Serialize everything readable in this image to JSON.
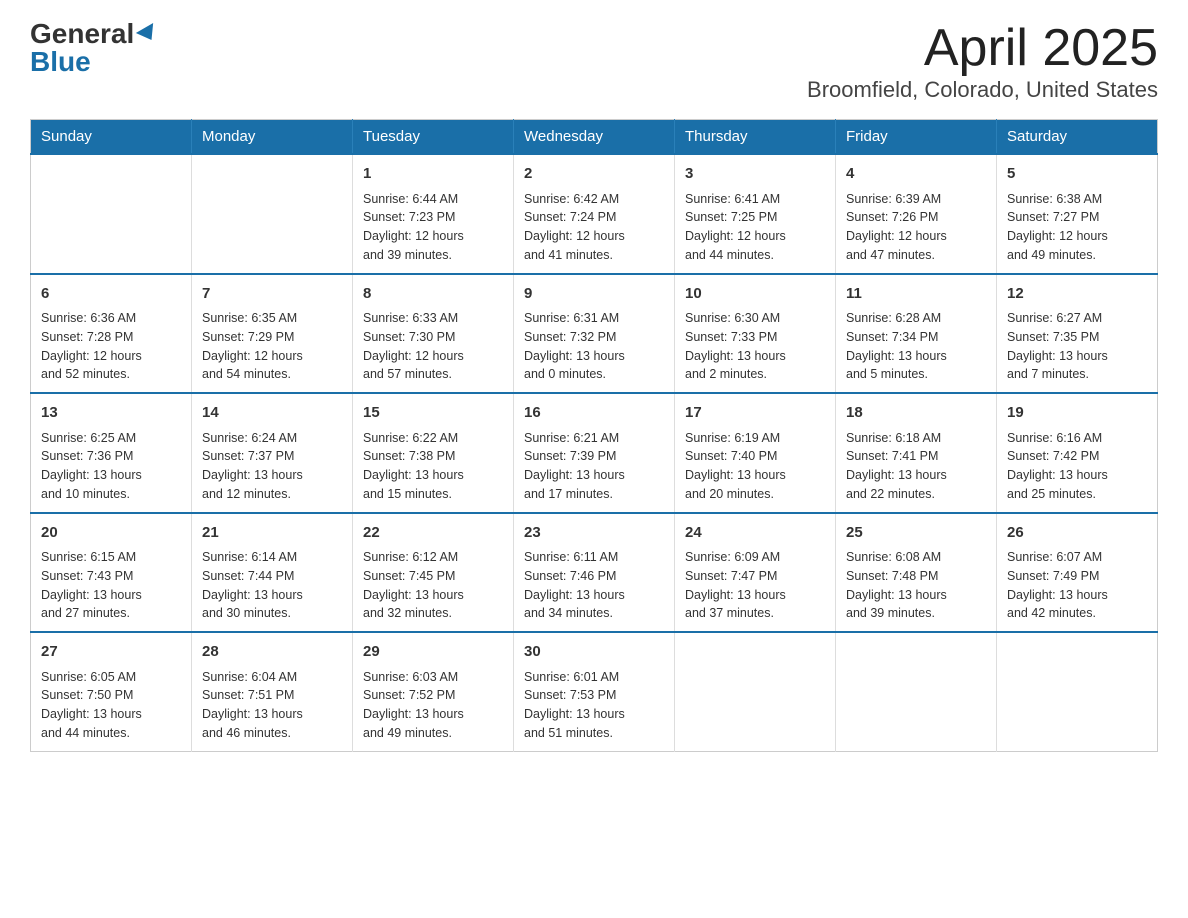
{
  "header": {
    "logo_general": "General",
    "logo_blue": "Blue",
    "title": "April 2025",
    "subtitle": "Broomfield, Colorado, United States"
  },
  "calendar": {
    "days_of_week": [
      "Sunday",
      "Monday",
      "Tuesday",
      "Wednesday",
      "Thursday",
      "Friday",
      "Saturday"
    ],
    "weeks": [
      [
        {
          "day": "",
          "info": ""
        },
        {
          "day": "",
          "info": ""
        },
        {
          "day": "1",
          "info": "Sunrise: 6:44 AM\nSunset: 7:23 PM\nDaylight: 12 hours\nand 39 minutes."
        },
        {
          "day": "2",
          "info": "Sunrise: 6:42 AM\nSunset: 7:24 PM\nDaylight: 12 hours\nand 41 minutes."
        },
        {
          "day": "3",
          "info": "Sunrise: 6:41 AM\nSunset: 7:25 PM\nDaylight: 12 hours\nand 44 minutes."
        },
        {
          "day": "4",
          "info": "Sunrise: 6:39 AM\nSunset: 7:26 PM\nDaylight: 12 hours\nand 47 minutes."
        },
        {
          "day": "5",
          "info": "Sunrise: 6:38 AM\nSunset: 7:27 PM\nDaylight: 12 hours\nand 49 minutes."
        }
      ],
      [
        {
          "day": "6",
          "info": "Sunrise: 6:36 AM\nSunset: 7:28 PM\nDaylight: 12 hours\nand 52 minutes."
        },
        {
          "day": "7",
          "info": "Sunrise: 6:35 AM\nSunset: 7:29 PM\nDaylight: 12 hours\nand 54 minutes."
        },
        {
          "day": "8",
          "info": "Sunrise: 6:33 AM\nSunset: 7:30 PM\nDaylight: 12 hours\nand 57 minutes."
        },
        {
          "day": "9",
          "info": "Sunrise: 6:31 AM\nSunset: 7:32 PM\nDaylight: 13 hours\nand 0 minutes."
        },
        {
          "day": "10",
          "info": "Sunrise: 6:30 AM\nSunset: 7:33 PM\nDaylight: 13 hours\nand 2 minutes."
        },
        {
          "day": "11",
          "info": "Sunrise: 6:28 AM\nSunset: 7:34 PM\nDaylight: 13 hours\nand 5 minutes."
        },
        {
          "day": "12",
          "info": "Sunrise: 6:27 AM\nSunset: 7:35 PM\nDaylight: 13 hours\nand 7 minutes."
        }
      ],
      [
        {
          "day": "13",
          "info": "Sunrise: 6:25 AM\nSunset: 7:36 PM\nDaylight: 13 hours\nand 10 minutes."
        },
        {
          "day": "14",
          "info": "Sunrise: 6:24 AM\nSunset: 7:37 PM\nDaylight: 13 hours\nand 12 minutes."
        },
        {
          "day": "15",
          "info": "Sunrise: 6:22 AM\nSunset: 7:38 PM\nDaylight: 13 hours\nand 15 minutes."
        },
        {
          "day": "16",
          "info": "Sunrise: 6:21 AM\nSunset: 7:39 PM\nDaylight: 13 hours\nand 17 minutes."
        },
        {
          "day": "17",
          "info": "Sunrise: 6:19 AM\nSunset: 7:40 PM\nDaylight: 13 hours\nand 20 minutes."
        },
        {
          "day": "18",
          "info": "Sunrise: 6:18 AM\nSunset: 7:41 PM\nDaylight: 13 hours\nand 22 minutes."
        },
        {
          "day": "19",
          "info": "Sunrise: 6:16 AM\nSunset: 7:42 PM\nDaylight: 13 hours\nand 25 minutes."
        }
      ],
      [
        {
          "day": "20",
          "info": "Sunrise: 6:15 AM\nSunset: 7:43 PM\nDaylight: 13 hours\nand 27 minutes."
        },
        {
          "day": "21",
          "info": "Sunrise: 6:14 AM\nSunset: 7:44 PM\nDaylight: 13 hours\nand 30 minutes."
        },
        {
          "day": "22",
          "info": "Sunrise: 6:12 AM\nSunset: 7:45 PM\nDaylight: 13 hours\nand 32 minutes."
        },
        {
          "day": "23",
          "info": "Sunrise: 6:11 AM\nSunset: 7:46 PM\nDaylight: 13 hours\nand 34 minutes."
        },
        {
          "day": "24",
          "info": "Sunrise: 6:09 AM\nSunset: 7:47 PM\nDaylight: 13 hours\nand 37 minutes."
        },
        {
          "day": "25",
          "info": "Sunrise: 6:08 AM\nSunset: 7:48 PM\nDaylight: 13 hours\nand 39 minutes."
        },
        {
          "day": "26",
          "info": "Sunrise: 6:07 AM\nSunset: 7:49 PM\nDaylight: 13 hours\nand 42 minutes."
        }
      ],
      [
        {
          "day": "27",
          "info": "Sunrise: 6:05 AM\nSunset: 7:50 PM\nDaylight: 13 hours\nand 44 minutes."
        },
        {
          "day": "28",
          "info": "Sunrise: 6:04 AM\nSunset: 7:51 PM\nDaylight: 13 hours\nand 46 minutes."
        },
        {
          "day": "29",
          "info": "Sunrise: 6:03 AM\nSunset: 7:52 PM\nDaylight: 13 hours\nand 49 minutes."
        },
        {
          "day": "30",
          "info": "Sunrise: 6:01 AM\nSunset: 7:53 PM\nDaylight: 13 hours\nand 51 minutes."
        },
        {
          "day": "",
          "info": ""
        },
        {
          "day": "",
          "info": ""
        },
        {
          "day": "",
          "info": ""
        }
      ]
    ]
  }
}
